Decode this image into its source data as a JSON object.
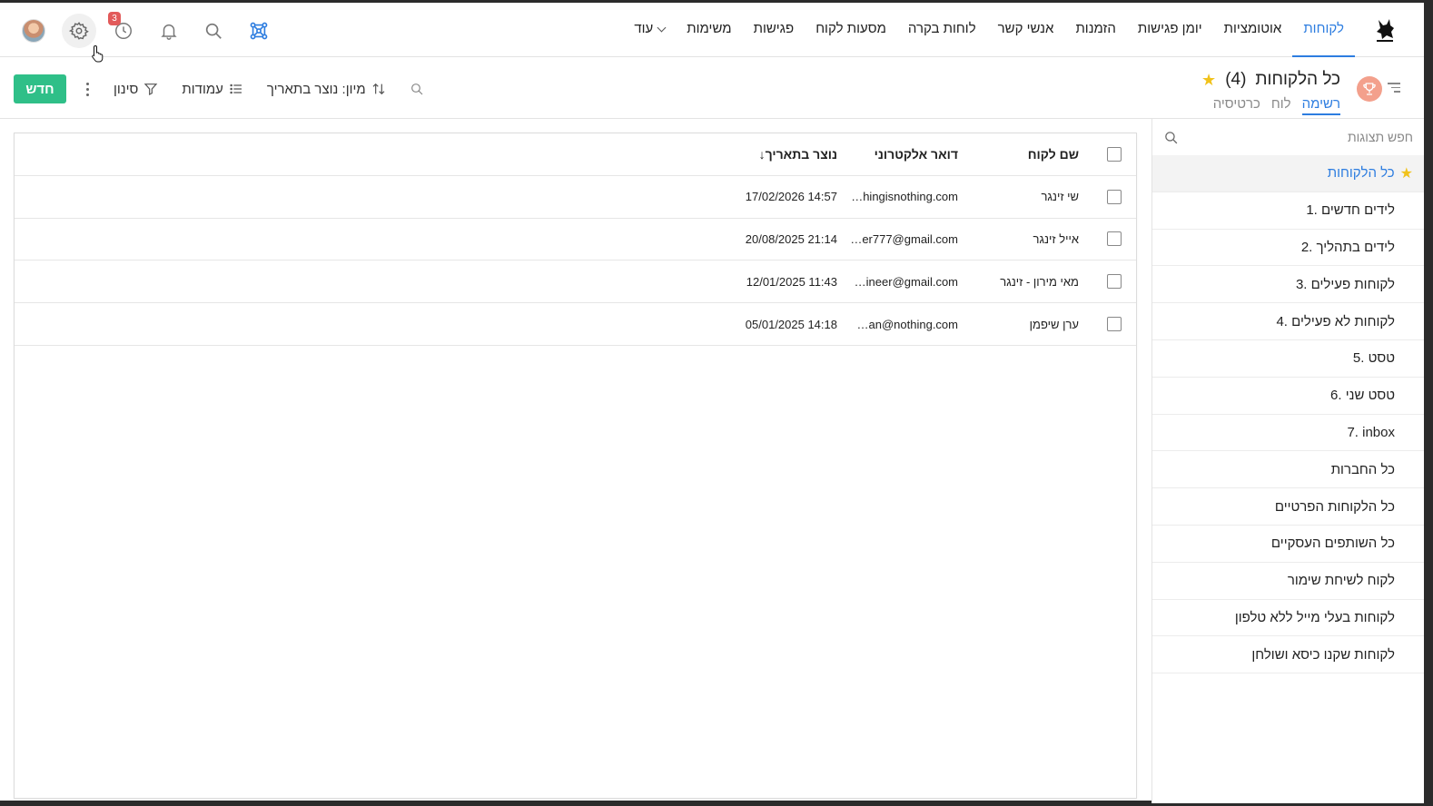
{
  "nav": {
    "tabs": [
      {
        "label": "לקוחות",
        "active": true
      },
      {
        "label": "אוטומציות",
        "active": false
      },
      {
        "label": "יומן פגישות",
        "active": false
      },
      {
        "label": "הזמנות",
        "active": false
      },
      {
        "label": "אנשי קשר",
        "active": false
      },
      {
        "label": "לוחות בקרה",
        "active": false
      },
      {
        "label": "מסעות לקוח",
        "active": false
      },
      {
        "label": "פגישות",
        "active": false
      },
      {
        "label": "משימות",
        "active": false
      }
    ],
    "more_label": "עוד",
    "history_badge": "3"
  },
  "view": {
    "title": "כל הלקוחות",
    "count": "(4)",
    "tabs": [
      {
        "label": "רשימה",
        "active": true
      },
      {
        "label": "לוח",
        "active": false
      },
      {
        "label": "כרטיסיה",
        "active": false
      }
    ]
  },
  "actions": {
    "new_label": "חדש",
    "filter_label": "סינון",
    "columns_label": "עמודות",
    "sort_label": "מיון: נוצר בתאריך"
  },
  "sidebar": {
    "search_placeholder": "חפש תצוגות",
    "items": [
      {
        "label": "כל הלקוחות",
        "active": true,
        "starred": true
      },
      {
        "label": "1. לידים חדשים"
      },
      {
        "label": "2. לידים בתהליך"
      },
      {
        "label": "3. לקוחות פעילים"
      },
      {
        "label": "4. לקוחות לא פעילים"
      },
      {
        "label": "5. טסט"
      },
      {
        "label": "6. טסט שני"
      },
      {
        "label": "7. inbox"
      },
      {
        "label": "כל החברות"
      },
      {
        "label": "כל הלקוחות הפרטיים"
      },
      {
        "label": "כל השותפים העסקיים"
      },
      {
        "label": "לקוח לשיחת שימור"
      },
      {
        "label": "לקוחות בעלי מייל ללא טלפון"
      },
      {
        "label": "לקוחות שקנו כיסא ושולחן"
      }
    ]
  },
  "table": {
    "columns": {
      "name": "שם לקוח",
      "email": "דואר אלקטרוני",
      "created": "נוצר בתאריך",
      "sort_arrow": "↓"
    },
    "rows": [
      {
        "name": "שי זינגר",
        "email": "…hingisnothing.com",
        "created": "17/02/2026 14:57"
      },
      {
        "name": "אייל זינגר",
        "email": "…er777@gmail.com",
        "created": "20/08/2025 21:14"
      },
      {
        "name": "מאי מירון - זינגר",
        "email": "…ineer@gmail.com",
        "created": "12/01/2025 11:43"
      },
      {
        "name": "ערן שיפמן",
        "email": "…an@nothing.com",
        "created": "05/01/2025 14:18"
      }
    ]
  },
  "colors": {
    "accent": "#2d7de0",
    "new_button": "#2fbf88",
    "star": "#f1c21b",
    "badge": "#e25a5a",
    "trophy_bg": "#f3a08c"
  }
}
